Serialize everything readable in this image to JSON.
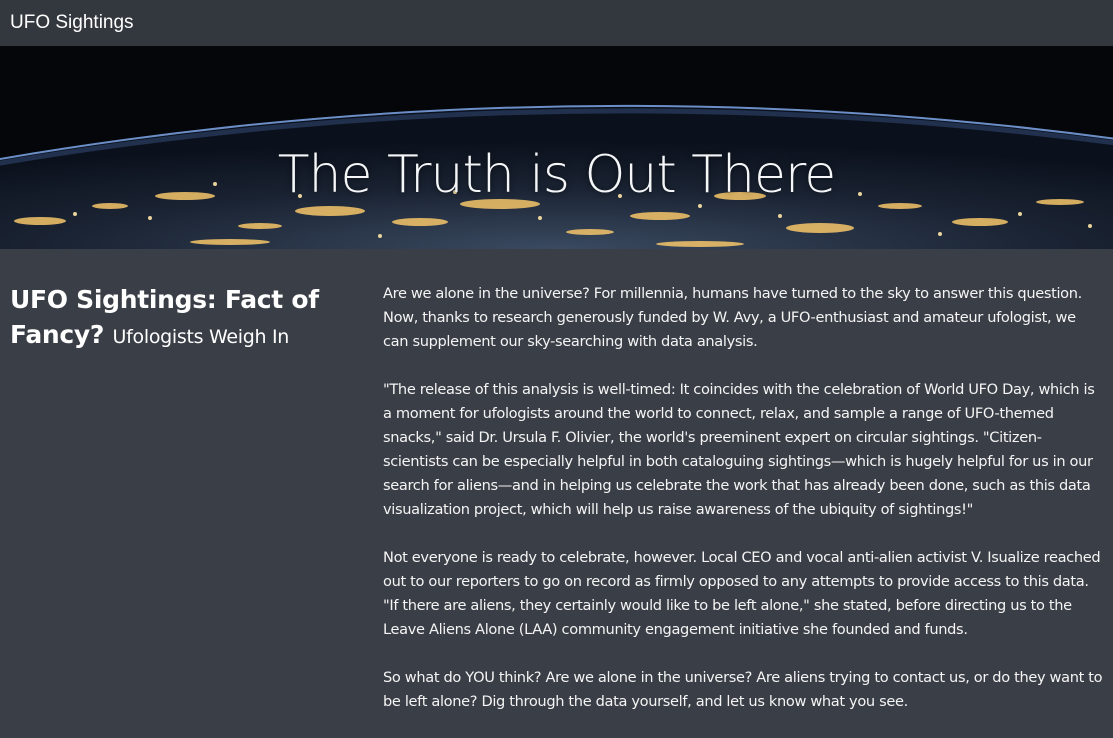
{
  "navbar": {
    "brand": "UFO Sightings"
  },
  "hero": {
    "title": "The Truth is Out There"
  },
  "article": {
    "headline": "UFO Sightings: Fact of Fancy?",
    "subhead": "Ufologists Weigh In",
    "paragraphs": [
      "Are we alone in the universe? For millennia, humans have turned to the sky to answer this question. Now, thanks to research generously funded by W. Avy, a UFO-enthusiast and amateur ufologist, we can supplement our sky-searching with data analysis.",
      "\"The release of this analysis is well-timed: It coincides with the celebration of World UFO Day, which is a moment for ufologists around the world to connect, relax, and sample a range of UFO-themed snacks,\" said Dr. Ursula F. Olivier, the world's preeminent expert on circular sightings. \"Citizen-scientists can be especially helpful in both cataloguing sightings—which is hugely helpful for us in our search for aliens—and in helping us celebrate the work that has already been done, such as this data visualization project, which will help us raise awareness of the ubiquity of sightings!\"",
      "Not everyone is ready to celebrate, however. Local CEO and vocal anti-alien activist V. Isualize reached out to our reporters to go on record as firmly opposed to any attempts to provide access to this data. \"If there are aliens, they certainly would like to be left alone,\" she stated, before directing us to the Leave Aliens Alone (LAA) community engagement initiative she founded and funds.",
      "So what do YOU think? Are we alone in the universe? Are aliens trying to contact us, or do they want to be left alone? Dig through the data yourself, and let us know what you see."
    ]
  },
  "colors": {
    "page_bg": "#3a3e46",
    "navbar_bg": "#33373e",
    "text": "#ffffff"
  }
}
